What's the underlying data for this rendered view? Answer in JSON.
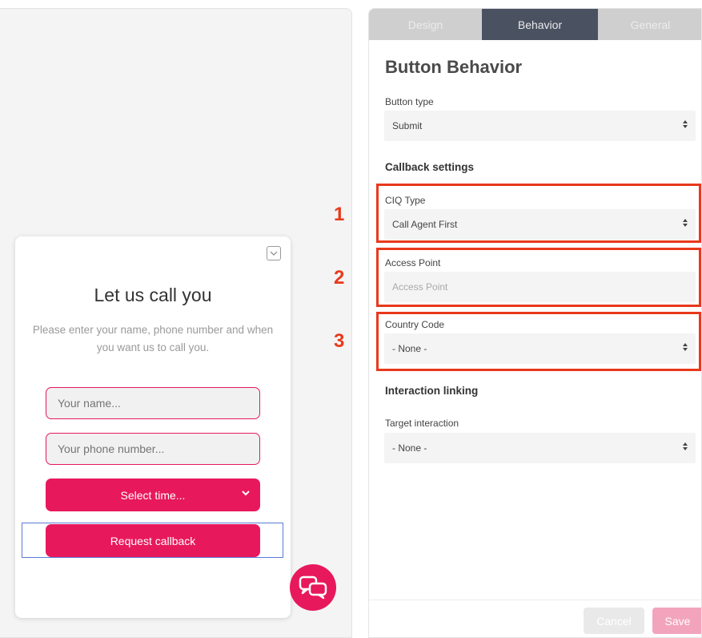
{
  "widget": {
    "title": "Let us call you",
    "description": "Please enter your name, phone number and when you want us to call you.",
    "name_placeholder": "Your name...",
    "phone_placeholder": "Your phone number...",
    "select_time_label": "Select time...",
    "submit_label": "Request callback"
  },
  "tabs": [
    {
      "label": "Design"
    },
    {
      "label": "Behavior"
    },
    {
      "label": "General"
    }
  ],
  "panel": {
    "title": "Button Behavior",
    "button_type_label": "Button type",
    "button_type_value": "Submit",
    "callback_section": "Callback settings",
    "ciq_type_label": "CIQ Type",
    "ciq_type_value": "Call Agent First",
    "access_point_label": "Access Point",
    "access_point_placeholder": "Access Point",
    "country_code_label": "Country Code",
    "country_code_value": "- None -",
    "interaction_section": "Interaction linking",
    "target_interaction_label": "Target interaction",
    "target_interaction_value": "- None -",
    "cancel_label": "Cancel",
    "save_label": "Save"
  },
  "annotations": [
    "1",
    "2",
    "3"
  ],
  "colors": {
    "accent": "#e8185d",
    "annotation": "#e8391c",
    "active_tab": "#4a5262"
  }
}
